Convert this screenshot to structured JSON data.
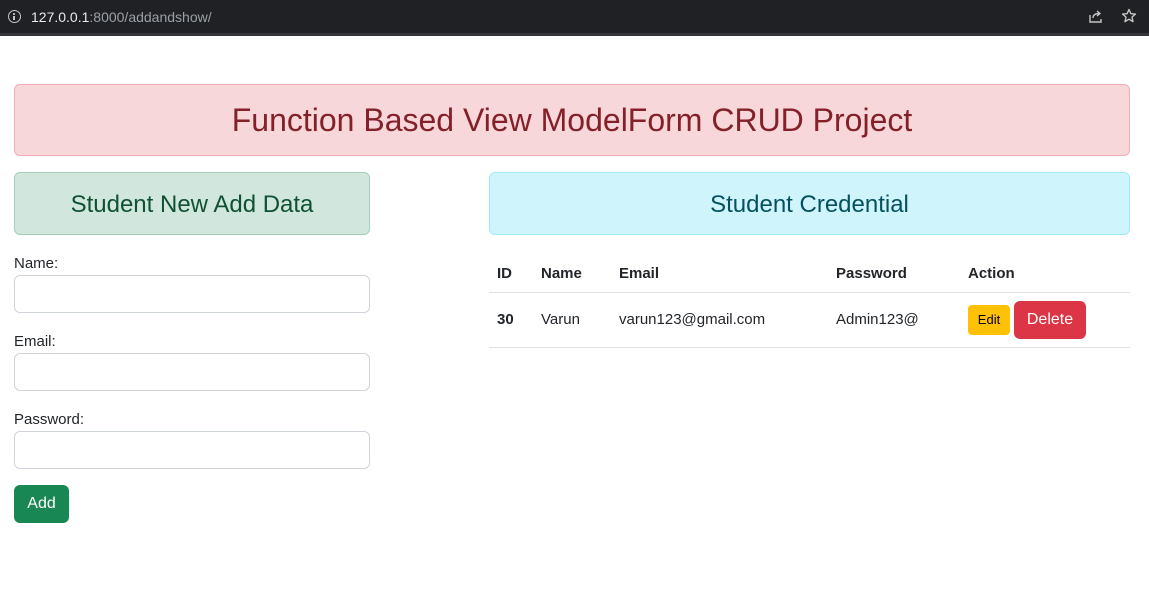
{
  "browser": {
    "url_host": "127.0.0.1",
    "url_rest": ":8000/addandshow/",
    "icons": [
      "info-icon",
      "share-icon",
      "star-icon"
    ]
  },
  "header": {
    "title": "Function Based View ModelForm CRUD Project"
  },
  "add_panel": {
    "title": "Student New Add Data",
    "name_label": "Name:",
    "name_value": "",
    "email_label": "Email:",
    "email_value": "",
    "password_label": "Password:",
    "password_value": "",
    "add_button": "Add"
  },
  "credential_panel": {
    "title": "Student Credential",
    "columns": [
      "ID",
      "Name",
      "Email",
      "Password",
      "Action"
    ],
    "rows": [
      {
        "id": "30",
        "name": "Varun",
        "email": "varun123@gmail.com",
        "password": "Admin123@",
        "edit_label": "Edit",
        "delete_label": "Delete"
      }
    ]
  },
  "colors": {
    "title_bg": "#f8d7da",
    "title_text": "#842029",
    "add_bg": "#d1e7dd",
    "add_text": "#0f5132",
    "cred_bg": "#cff4fc",
    "cred_text": "#055160",
    "add_button": "#198754",
    "edit_button": "#ffc107",
    "delete_button": "#dc3545"
  }
}
